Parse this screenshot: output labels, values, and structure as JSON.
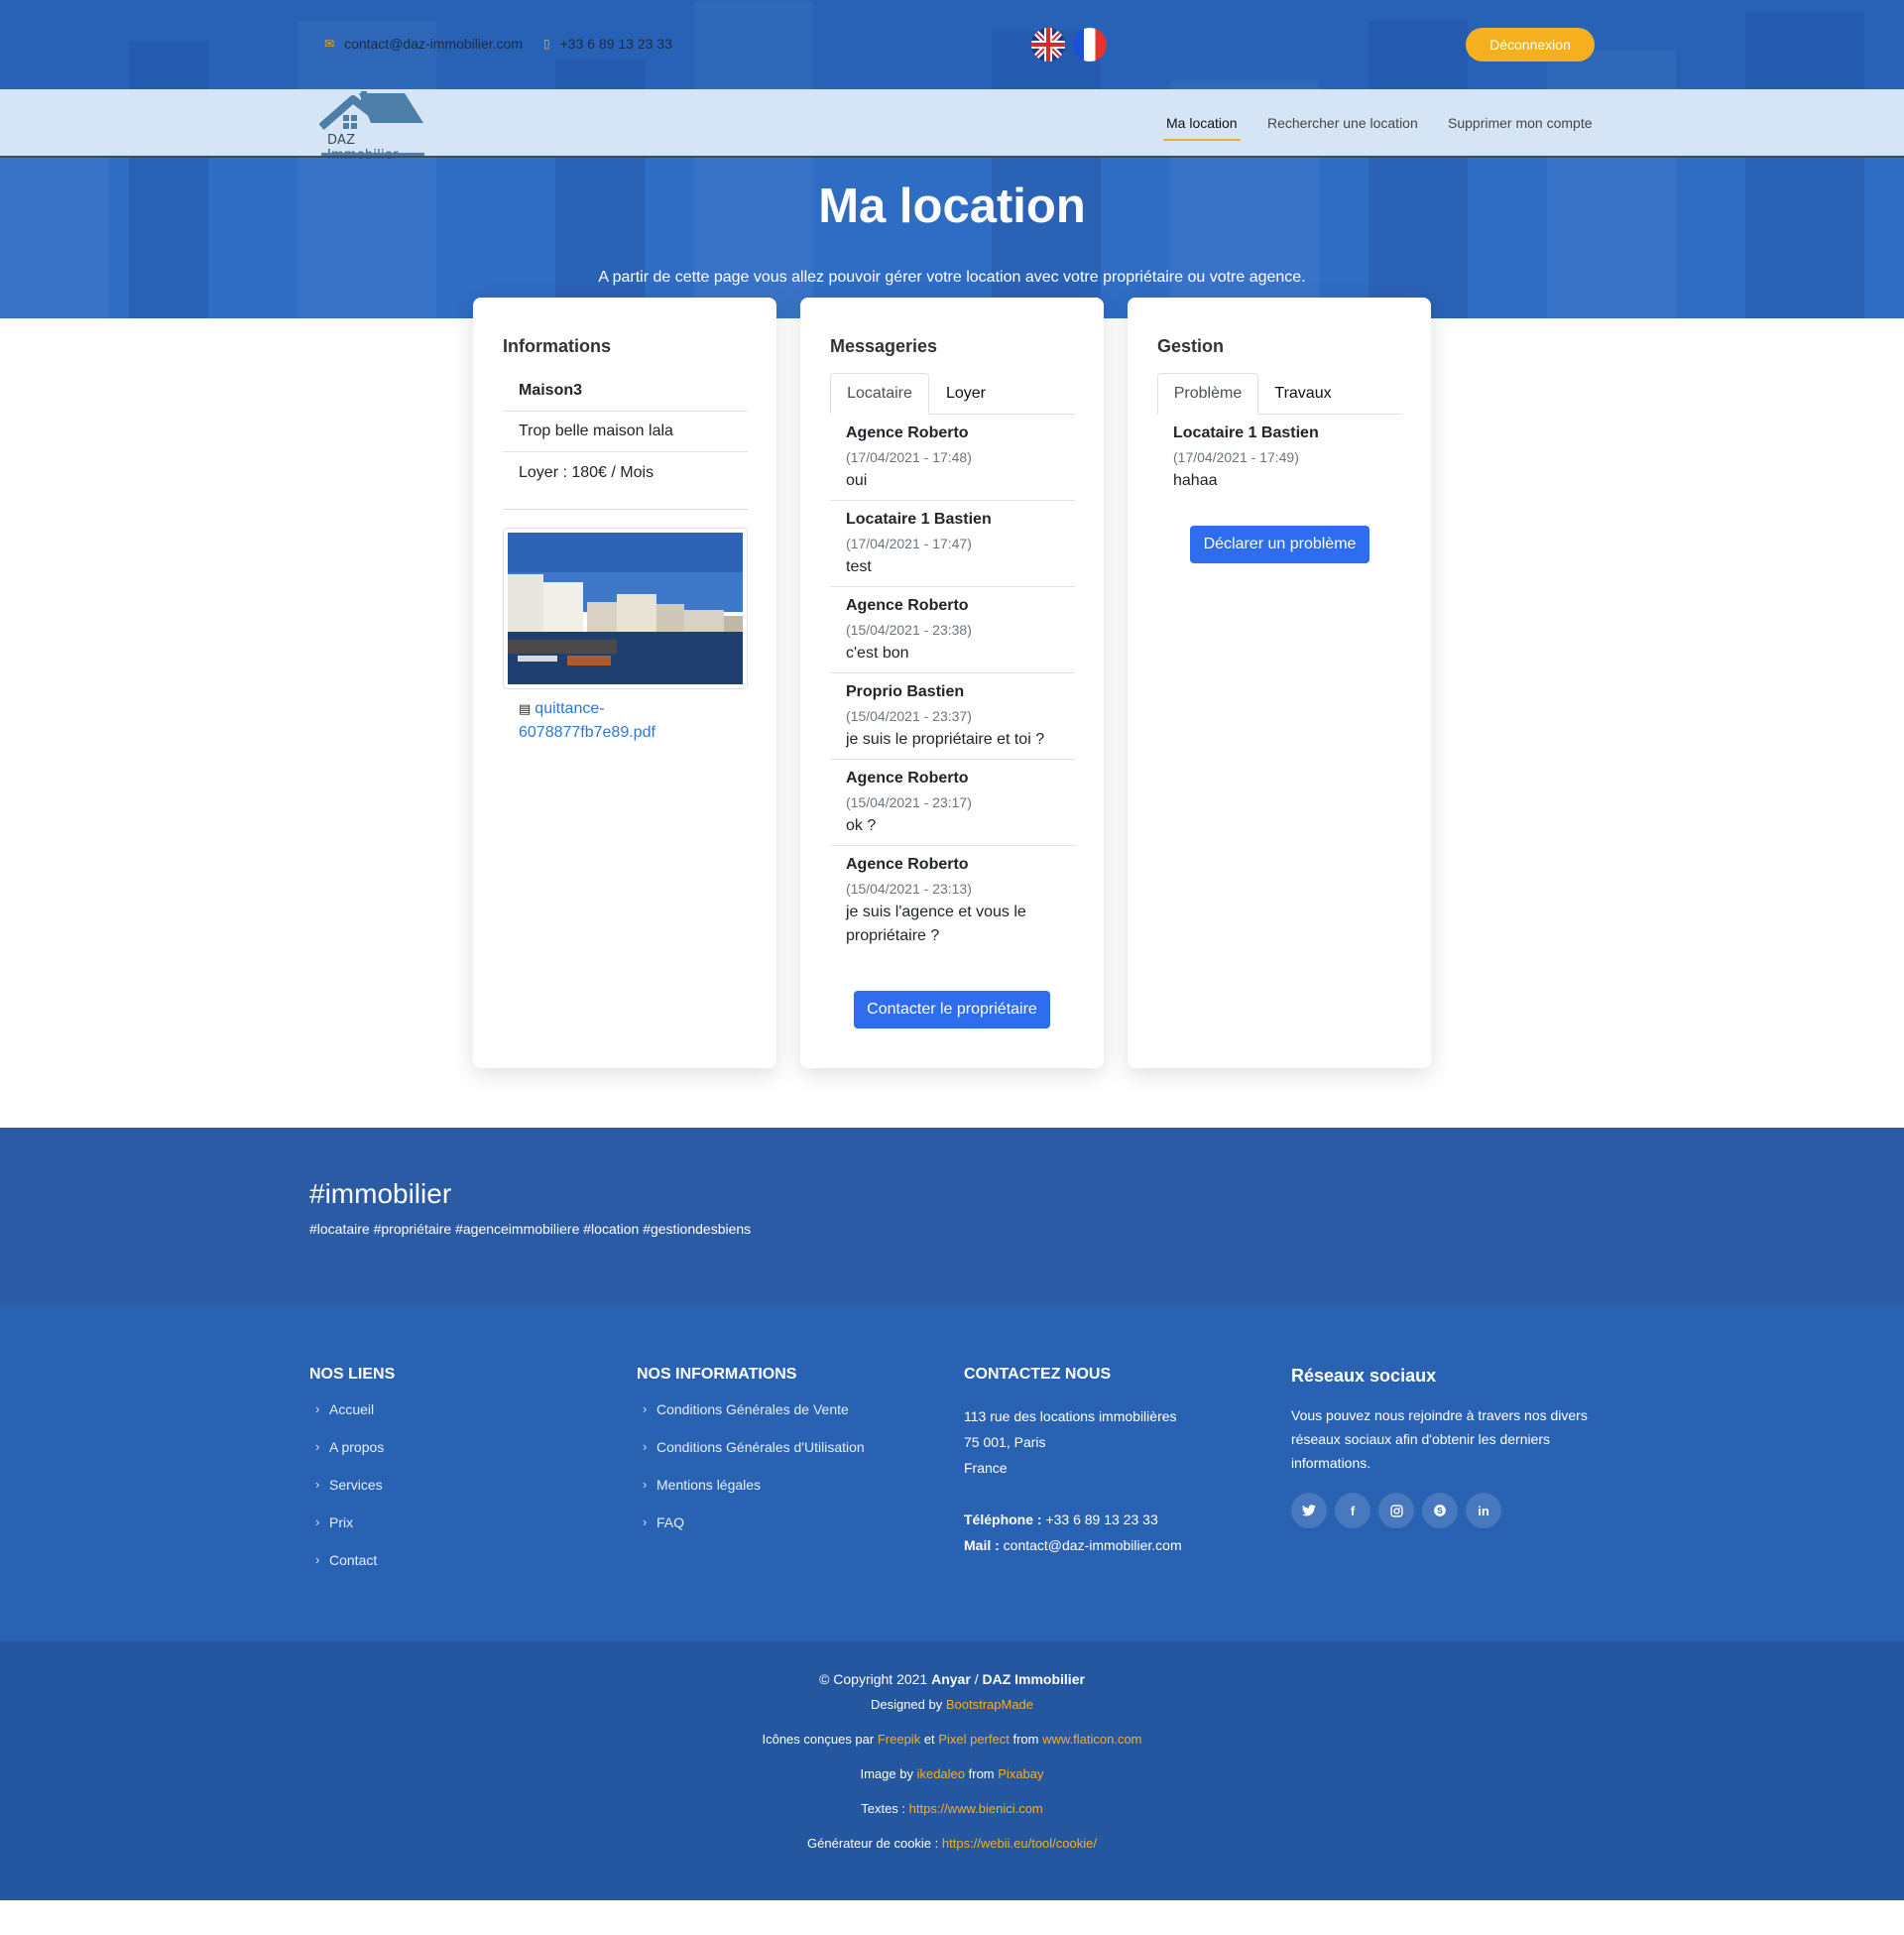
{
  "topbar": {
    "email": "contact@daz-immobilier.com",
    "phone": "+33 6 89 13 23 33",
    "logout": "Déconnexion"
  },
  "nav": {
    "logo_text": "DAZ Immobilier",
    "items": [
      {
        "label": "Ma location",
        "active": true
      },
      {
        "label": "Rechercher une location",
        "active": false
      },
      {
        "label": "Supprimer mon compte",
        "active": false
      }
    ]
  },
  "hero": {
    "title": "Ma location",
    "subtitle": "A partir de cette page vous allez pouvoir gérer votre location avec votre propriétaire ou votre agence."
  },
  "informations": {
    "title": "Informations",
    "name": "Maison3",
    "description": "Trop belle maison lala",
    "rent": "Loyer : 180€ / Mois",
    "file": "quittance-6078877fb7e89.pdf"
  },
  "messageries": {
    "title": "Messageries",
    "tabs": [
      "Locataire",
      "Loyer"
    ],
    "messages": [
      {
        "author": "Agence Roberto",
        "date": "(17/04/2021 - 17:48)",
        "text": "oui"
      },
      {
        "author": "Locataire 1 Bastien",
        "date": "(17/04/2021 - 17:47)",
        "text": "test"
      },
      {
        "author": "Agence Roberto",
        "date": "(15/04/2021 - 23:38)",
        "text": "c'est bon"
      },
      {
        "author": "Proprio Bastien",
        "date": "(15/04/2021 - 23:37)",
        "text": "je suis le propriétaire et toi ?"
      },
      {
        "author": "Agence Roberto",
        "date": "(15/04/2021 - 23:17)",
        "text": "ok ?"
      },
      {
        "author": "Agence Roberto",
        "date": "(15/04/2021 - 23:13)",
        "text": "je suis l'agence et vous le propriétaire ?"
      }
    ],
    "button": "Contacter le propriétaire"
  },
  "gestion": {
    "title": "Gestion",
    "tabs": [
      "Problème",
      "Travaux"
    ],
    "messages": [
      {
        "author": "Locataire 1 Bastien",
        "date": "(17/04/2021 - 17:49)",
        "text": "hahaa"
      }
    ],
    "button": "Déclarer un problème"
  },
  "band": {
    "title": "#immobilier",
    "tags": "#locataire #propriétaire #agenceimmobiliere #location #gestiondesbiens"
  },
  "footer": {
    "links_title": "NOS LIENS",
    "links": [
      "Accueil",
      "A propos",
      "Services",
      "Prix",
      "Contact"
    ],
    "info_title": "NOS INFORMATIONS",
    "info_links": [
      "Conditions Générales de Vente",
      "Conditions Générales d'Utilisation",
      "Mentions légales",
      "FAQ"
    ],
    "contact_title": "CONTACTEZ NOUS",
    "address_1": "113 rue des locations immobilières",
    "address_2": "75 001, Paris",
    "address_3": "France",
    "phone_label": "Téléphone :",
    "phone": "+33 6 89 13 23 33",
    "mail_label": "Mail :",
    "mail": "contact@daz-immobilier.com",
    "social_title": "Réseaux sociaux",
    "social_desc": "Vous pouvez nous rejoindre à travers nos divers réseaux sociaux afin d'obtenir les derniers informations.",
    "socials": [
      "twitter-icon",
      "facebook-icon",
      "instagram-icon",
      "skype-icon",
      "linkedin-icon"
    ]
  },
  "copyright": {
    "prefix": "© Copyright 2021",
    "brand1": "Anyar",
    "slash": "/",
    "brand2": "DAZ Immobilier",
    "designed_by": "Designed by",
    "designer": "BootstrapMade",
    "icons_prefix": "Icônes conçues par",
    "icons_a": "Freepik",
    "icons_et": "et",
    "icons_b": "Pixel perfect",
    "icons_from": "from",
    "icons_site": "www.flaticon.com",
    "image_by": "Image by",
    "image_author": "ikedaleo",
    "image_from": "from",
    "image_site": "Pixabay",
    "texts_label": "Textes :",
    "texts_url": "https://www.bienici.com",
    "cookie_label": "Générateur de cookie :",
    "cookie_url": "https://webii.eu/tool/cookie/"
  }
}
